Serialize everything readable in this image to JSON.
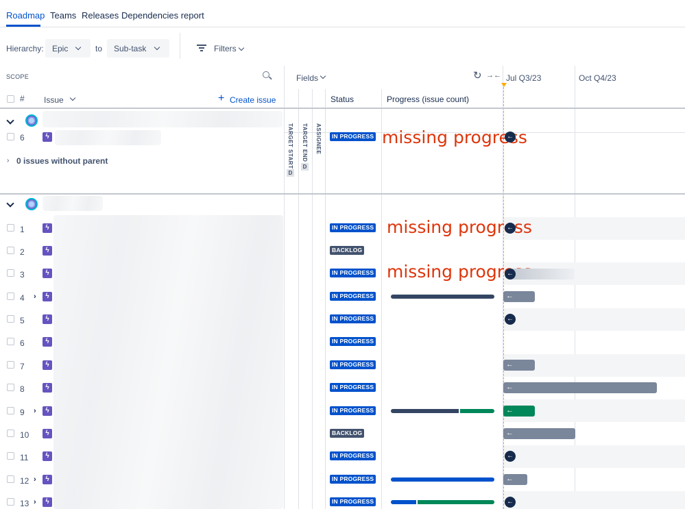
{
  "tabs": [
    {
      "label": "Roadmap"
    },
    {
      "label": "Teams"
    },
    {
      "label": "Releases"
    },
    {
      "label": "Dependencies report"
    }
  ],
  "toolbar": {
    "hierarchy_label": "Hierarchy:",
    "from_value": "Epic",
    "to_label": "to",
    "to_value": "Sub-task",
    "filters_label": "Filters"
  },
  "scope": {
    "title": "SCOPE",
    "col_number": "#",
    "col_issue": "Issue",
    "create_issue": "Create issue"
  },
  "fields": {
    "label": "Fields",
    "col_target_start": "TARGET START",
    "col_target_end": "TARGET END",
    "col_assignee": "ASSIGNEE",
    "date_marker": "D",
    "col_status": "Status",
    "col_progress": "Progress (issue count)"
  },
  "timeline": {
    "q3": "Jul Q3/23",
    "q4": "Oct Q4/23"
  },
  "group1": {
    "row_number": "6",
    "status": "IN PROGRESS",
    "annotation": "missing progress",
    "without_parent": "0 issues without parent"
  },
  "rows": [
    {
      "num": "1",
      "status": "IN PROGRESS",
      "annotation": "missing progress"
    },
    {
      "num": "2",
      "status": "BACKLOG"
    },
    {
      "num": "3",
      "status": "IN PROGRESS",
      "annotation": "missing progress"
    },
    {
      "num": "4",
      "status": "IN PROGRESS"
    },
    {
      "num": "5",
      "status": "IN PROGRESS"
    },
    {
      "num": "6",
      "status": "IN PROGRESS"
    },
    {
      "num": "7",
      "status": "IN PROGRESS"
    },
    {
      "num": "8",
      "status": "IN PROGRESS"
    },
    {
      "num": "9",
      "status": "IN PROGRESS"
    },
    {
      "num": "10",
      "status": "BACKLOG"
    },
    {
      "num": "11",
      "status": "IN PROGRESS"
    },
    {
      "num": "12",
      "status": "IN PROGRESS"
    },
    {
      "num": "13",
      "status": "IN PROGRESS"
    }
  ],
  "colors": {
    "accent": "#0052cc",
    "epic": "#6554c0",
    "done": "#00875a",
    "in_progress_bar": "#344563",
    "timeline_bar": "#7a869a",
    "annotation": "#de350b"
  }
}
